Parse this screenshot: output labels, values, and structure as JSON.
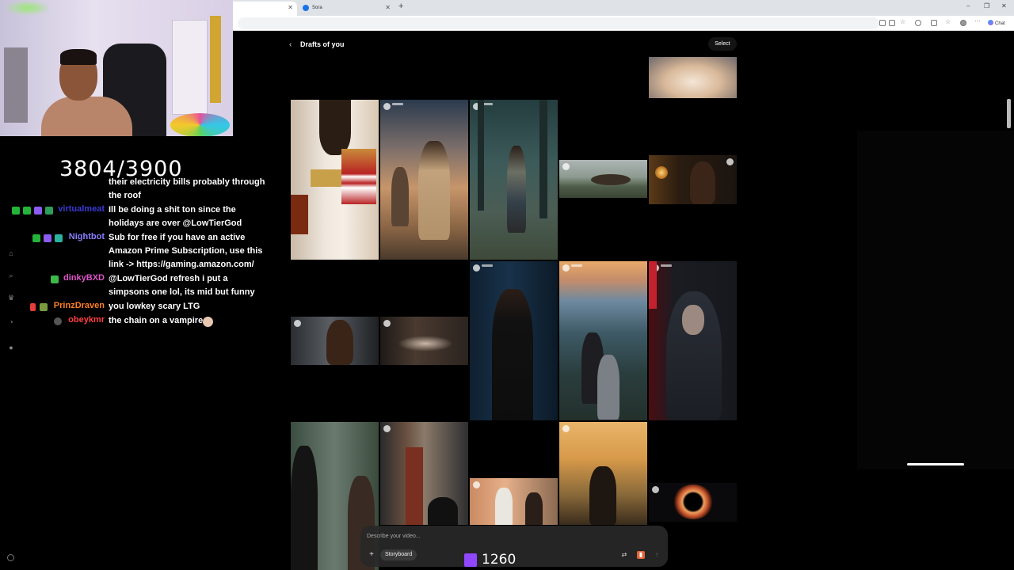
{
  "browser": {
    "tabs": [
      {
        "label": ""
      },
      {
        "label": "Sora"
      }
    ],
    "window_controls": [
      "–",
      "❐",
      "✕"
    ],
    "chat_button": "Chat"
  },
  "stream": {
    "counter": "3804/3900",
    "view_count": "1260",
    "chat": [
      {
        "user": "",
        "user_color": "#e64a4a",
        "lines": [
          "their electricity bills probably through",
          "the roof"
        ]
      },
      {
        "user": "virtualmeat",
        "user_color": "#3a3ad6",
        "lines": [
          "Ill be doing a shit ton since the",
          "holidays are over @LowTierGod"
        ]
      },
      {
        "user": "Nightbot",
        "user_color": "#8a7fff",
        "lines": [
          "Sub for free if you have an active",
          "Amazon Prime Subscription, use this",
          "link -> https://gaming.amazon.com/"
        ]
      },
      {
        "user": "dinkyBXD",
        "user_color": "#e055c8",
        "lines": [
          "@LowTierGod refresh i put a",
          "simpsons one lol, its mid but funny"
        ]
      },
      {
        "user": "PrinzDraven",
        "user_color": "#ff7f24",
        "lines": [
          "you lowkey scary LTG"
        ]
      },
      {
        "user": "obeykmr",
        "user_color": "#ff4040",
        "lines": [
          "the chain on a vampire"
        ]
      }
    ]
  },
  "sora": {
    "page_title": "Drafts of you",
    "back_icon": "chevron-left-icon",
    "select_label": "Select",
    "composer": {
      "placeholder": "Describe your video...",
      "storyboard_label": "Storyboard"
    }
  },
  "colors": {
    "twitch": "#9146ff",
    "background": "#000000"
  }
}
